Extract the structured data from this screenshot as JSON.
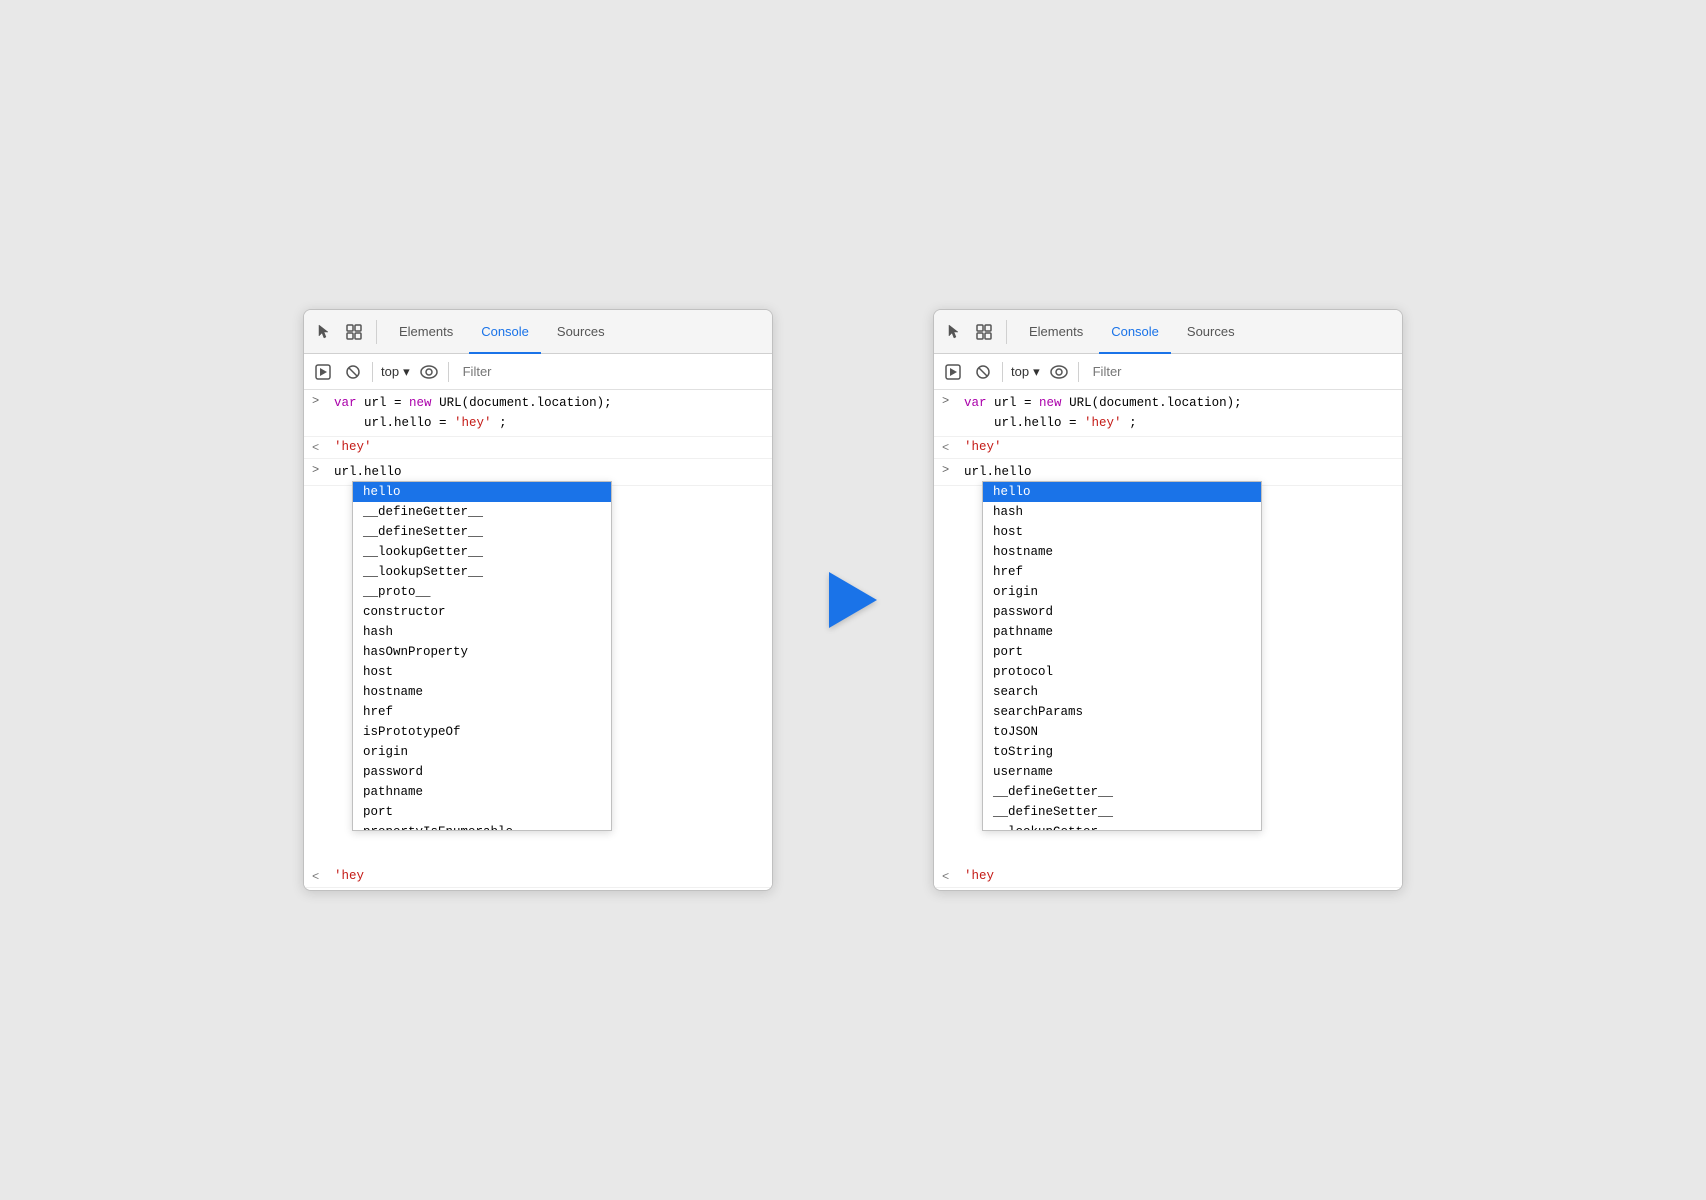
{
  "panels": [
    {
      "id": "left",
      "tabs": [
        {
          "label": "Elements",
          "active": false
        },
        {
          "label": "Console",
          "active": true
        },
        {
          "label": "Sources",
          "active": false
        }
      ],
      "toolbar": {
        "top_label": "top",
        "filter_placeholder": "Filter"
      },
      "console": {
        "lines": [
          {
            "type": "input",
            "prompt": ">",
            "code": [
              "var url = new URL(document.location);",
              "url.hello = 'hey';"
            ]
          },
          {
            "type": "output",
            "prompt": "<",
            "text": "'hey'"
          },
          {
            "type": "input",
            "prompt": ">",
            "code": [
              "url.hello"
            ]
          },
          {
            "type": "output-partial",
            "prompt": "<",
            "partial_text": "'hey"
          }
        ]
      },
      "autocomplete": {
        "items": [
          {
            "label": "hello",
            "selected": true
          },
          {
            "label": "__defineGetter__",
            "selected": false
          },
          {
            "label": "__defineSetter__",
            "selected": false
          },
          {
            "label": "__lookupGetter__",
            "selected": false
          },
          {
            "label": "__lookupSetter__",
            "selected": false
          },
          {
            "label": "__proto__",
            "selected": false
          },
          {
            "label": "constructor",
            "selected": false
          },
          {
            "label": "hash",
            "selected": false
          },
          {
            "label": "hasOwnProperty",
            "selected": false
          },
          {
            "label": "host",
            "selected": false
          },
          {
            "label": "hostname",
            "selected": false
          },
          {
            "label": "href",
            "selected": false
          },
          {
            "label": "isPrototypeOf",
            "selected": false
          },
          {
            "label": "origin",
            "selected": false
          },
          {
            "label": "password",
            "selected": false
          },
          {
            "label": "pathname",
            "selected": false
          },
          {
            "label": "port",
            "selected": false
          },
          {
            "label": "propertyIsEnumerable",
            "selected": false
          }
        ]
      }
    },
    {
      "id": "right",
      "tabs": [
        {
          "label": "Elements",
          "active": false
        },
        {
          "label": "Console",
          "active": true
        },
        {
          "label": "Sources",
          "active": false
        }
      ],
      "toolbar": {
        "top_label": "top",
        "filter_placeholder": "Filter"
      },
      "console": {
        "lines": [
          {
            "type": "input",
            "prompt": ">",
            "code": [
              "var url = new URL(document.location);",
              "url.hello = 'hey';"
            ]
          },
          {
            "type": "output",
            "prompt": "<",
            "text": "'hey'"
          },
          {
            "type": "input",
            "prompt": ">",
            "code": [
              "url.hello"
            ]
          },
          {
            "type": "output-partial",
            "prompt": "<",
            "partial_text": "'hey"
          }
        ]
      },
      "autocomplete": {
        "items": [
          {
            "label": "hello",
            "selected": true
          },
          {
            "label": "hash",
            "selected": false
          },
          {
            "label": "host",
            "selected": false
          },
          {
            "label": "hostname",
            "selected": false
          },
          {
            "label": "href",
            "selected": false
          },
          {
            "label": "origin",
            "selected": false
          },
          {
            "label": "password",
            "selected": false
          },
          {
            "label": "pathname",
            "selected": false
          },
          {
            "label": "port",
            "selected": false
          },
          {
            "label": "protocol",
            "selected": false
          },
          {
            "label": "search",
            "selected": false
          },
          {
            "label": "searchParams",
            "selected": false
          },
          {
            "label": "toJSON",
            "selected": false
          },
          {
            "label": "toString",
            "selected": false
          },
          {
            "label": "username",
            "selected": false
          },
          {
            "label": "__defineGetter__",
            "selected": false
          },
          {
            "label": "__defineSetter__",
            "selected": false
          },
          {
            "label": "__lookupGetter__",
            "selected": false
          }
        ]
      }
    }
  ],
  "arrow": {
    "direction": "right"
  }
}
